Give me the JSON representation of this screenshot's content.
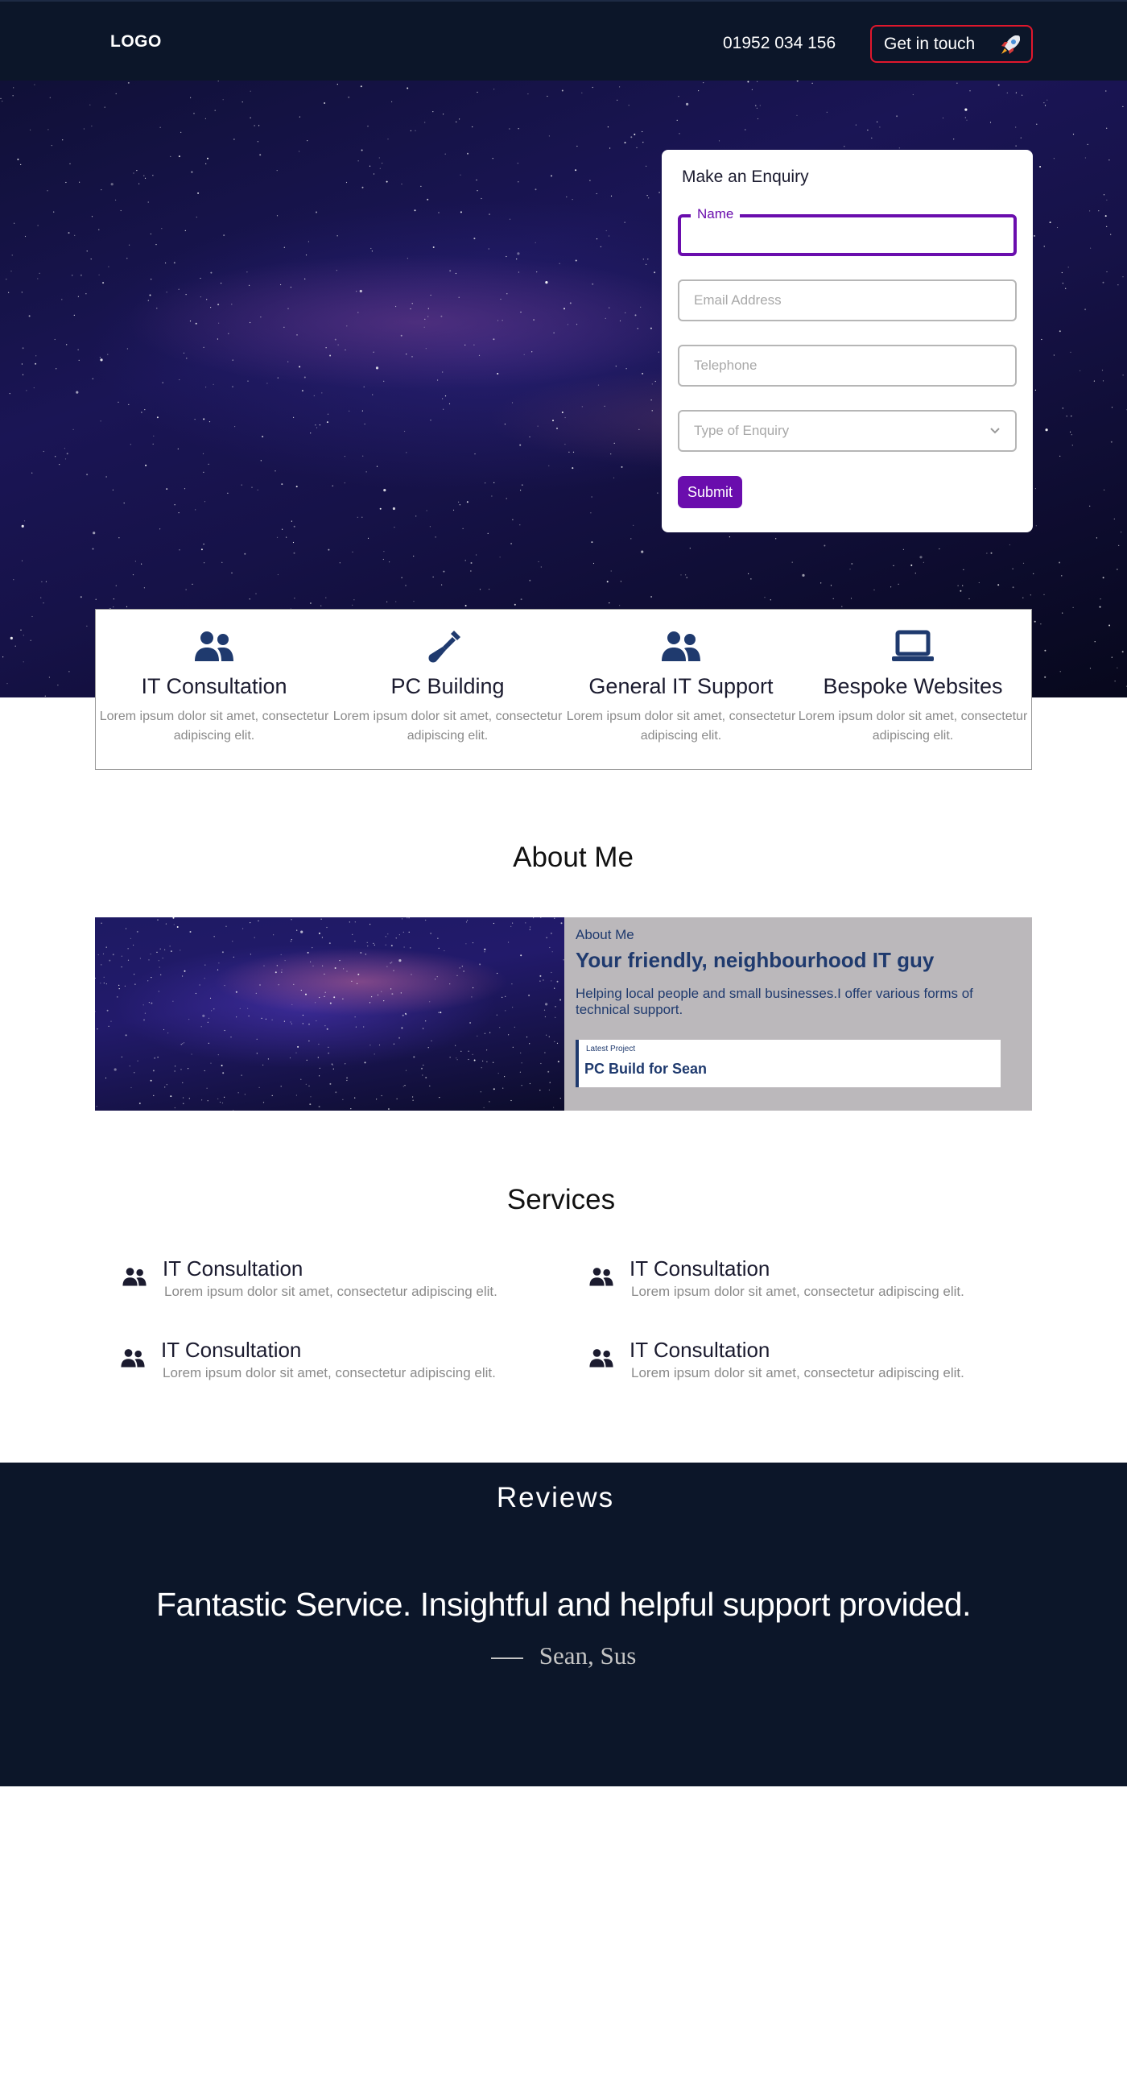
{
  "header": {
    "logo": "LOGO",
    "phone": "01952 034 156",
    "cta_label": "Get in touch",
    "cta_icon": "rocket-icon",
    "cta_border_color": "#e0172c",
    "background": "#0c1629"
  },
  "enquiry": {
    "title": "Make an Enquiry",
    "name_label": "Name",
    "name_value": "",
    "email_placeholder": "Email Address",
    "telephone_placeholder": "Telephone",
    "enquiry_type_placeholder": "Type of Enquiry",
    "submit_label": "Submit",
    "accent_color": "#6a0dad"
  },
  "features": [
    {
      "icon": "users-icon",
      "title": "IT Consultation",
      "desc": "Lorem ipsum dolor sit amet, consectetur adipiscing elit."
    },
    {
      "icon": "screwdriver-icon",
      "title": "PC Building",
      "desc": "Lorem ipsum dolor sit amet, consectetur adipiscing elit."
    },
    {
      "icon": "users-icon",
      "title": "General IT Support",
      "desc": "Lorem ipsum dolor sit amet, consectetur adipiscing elit."
    },
    {
      "icon": "laptop-icon",
      "title": "Bespoke Websites",
      "desc": "Lorem ipsum dolor sit amet, consectetur adipiscing elit."
    }
  ],
  "about": {
    "section_title": "About Me",
    "kicker": "About Me",
    "headline": "Your friendly, neighbourhood IT guy",
    "subtitle": "Helping local people and small businesses.I offer various forms of technical support.",
    "latest_label": "Latest Project",
    "latest_title": "PC Build for Sean"
  },
  "services": {
    "section_title": "Services",
    "items": [
      {
        "icon": "users-icon",
        "title": "IT Consultation",
        "desc": "Lorem ipsum dolor sit amet, consectetur adipiscing elit."
      },
      {
        "icon": "users-icon",
        "title": "IT Consultation",
        "desc": "Lorem ipsum dolor sit amet, consectetur adipiscing elit."
      },
      {
        "icon": "users-icon",
        "title": "IT Consultation",
        "desc": "Lorem ipsum dolor sit amet, consectetur adipiscing elit."
      },
      {
        "icon": "users-icon",
        "title": "IT Consultation",
        "desc": "Lorem ipsum dolor sit amet, consectetur adipiscing elit."
      }
    ]
  },
  "reviews": {
    "section_title": "Reviews",
    "quote": "Fantastic Service. Insightful and helpful support provided.",
    "author": "Sean, Sus"
  }
}
